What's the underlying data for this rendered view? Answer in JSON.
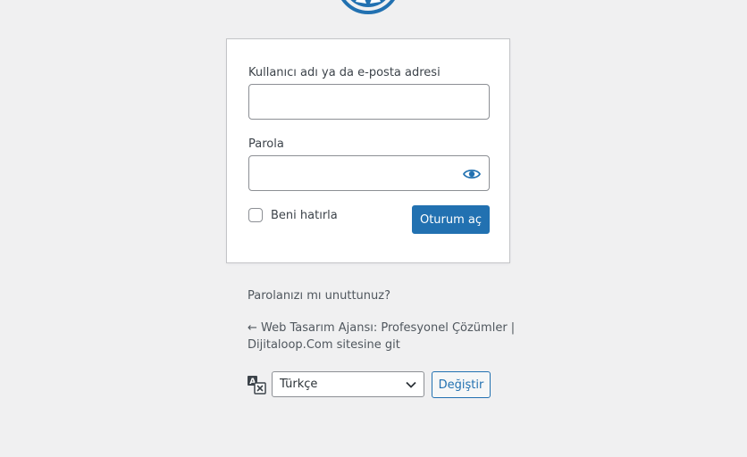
{
  "branding": {
    "logo_icon": "wordpress-logo-icon",
    "accent_color": "#2271b1"
  },
  "login_form": {
    "username_label": "Kullanıcı adı ya da e-posta adresi",
    "username_value": "",
    "password_label": "Parola",
    "password_value": "",
    "show_password_icon": "eye-icon",
    "remember_label": "Beni hatırla",
    "remember_checked": false,
    "submit_label": "Oturum aç"
  },
  "links": {
    "lost_password": "Parolanızı mı unuttunuz?",
    "back_to_site_line1": "← Web Tasarım Ajansı: Profesyonel Çözümler |",
    "back_to_site_line2": "Dijitaloop.Com sitesine git"
  },
  "language": {
    "icon": "translation-icon",
    "selected": "Türkçe",
    "change_label": "Değiştir"
  }
}
